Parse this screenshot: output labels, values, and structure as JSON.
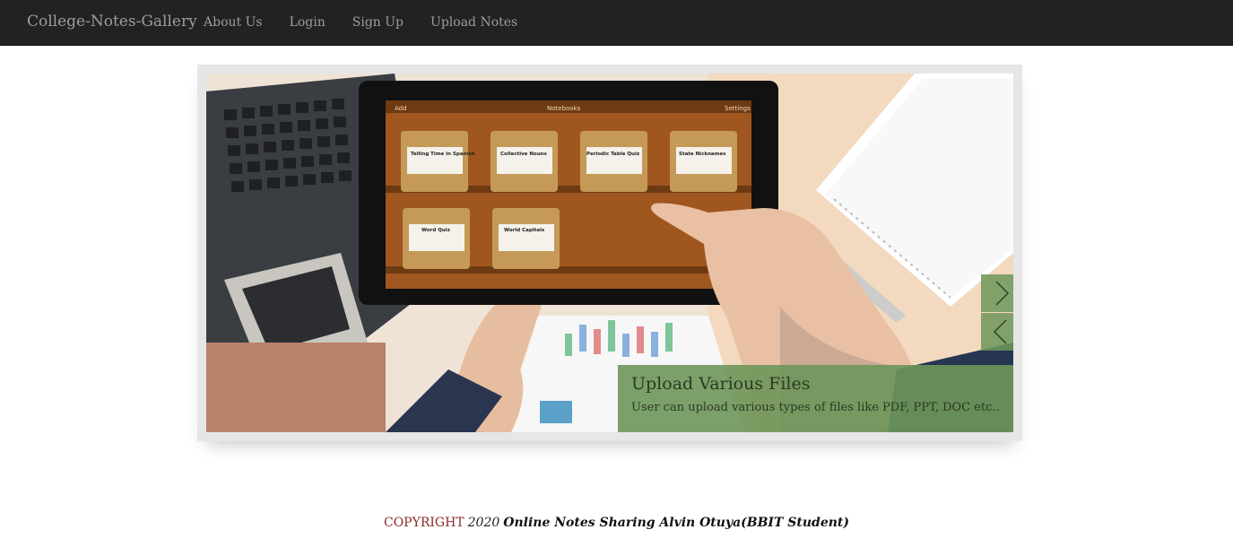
{
  "navbar": {
    "brand": "College-Notes-Gallery",
    "links": [
      "About Us",
      "Login",
      "Sign Up",
      "Upload Notes"
    ]
  },
  "slider": {
    "caption_title": "Upload Various Files",
    "caption_text": "User can upload various types of files like PDF, PPT, DOC etc..",
    "tablet_header": "Notebooks",
    "tablet_left": "Add",
    "tablet_right": "Settings",
    "notebooks": [
      "Telling Time in Spanish",
      "Collective Nouns",
      "Periodic Table Quiz",
      "State Nicknames",
      "Word Quiz",
      "World Capitals"
    ],
    "accent_color": "#6e965a"
  },
  "footer": {
    "copyright": "COPYRIGHT",
    "year": "2020",
    "text": "Online Notes Sharing Alvin Otuya(BBIT Student)"
  }
}
